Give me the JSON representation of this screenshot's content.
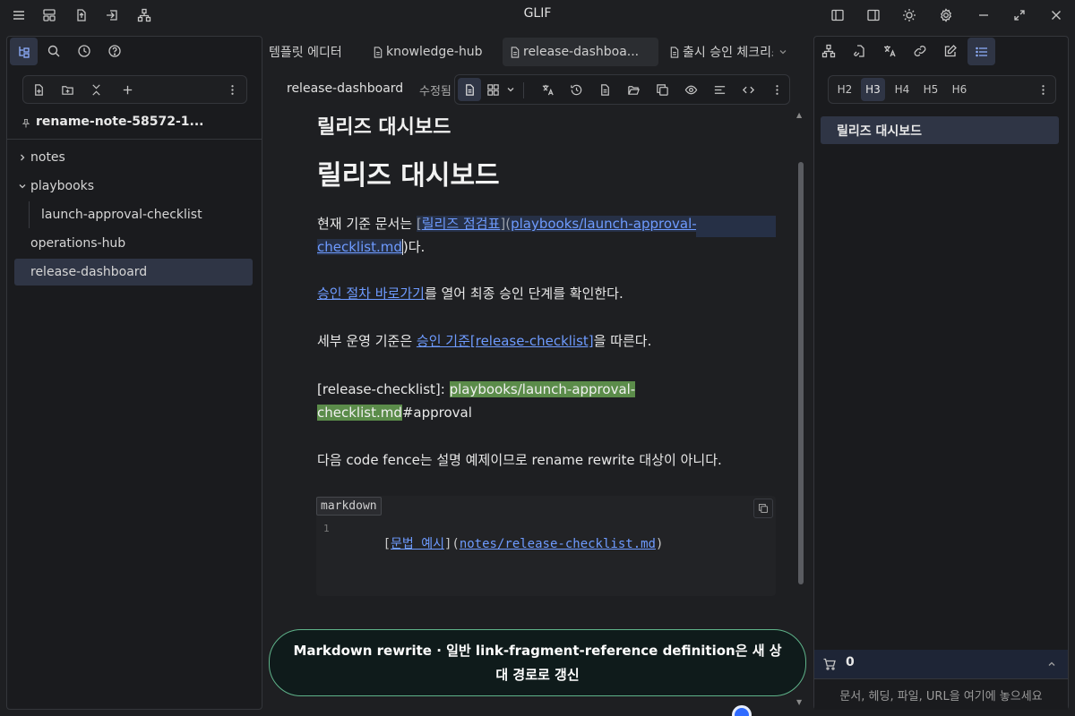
{
  "app": {
    "title": "GLIF"
  },
  "left": {
    "pinned_note": "rename-note-58572-1...",
    "tree": [
      {
        "label": "notes",
        "type": "folder",
        "expanded": false
      },
      {
        "label": "playbooks",
        "type": "folder",
        "expanded": true
      },
      {
        "label": "launch-approval-checklist",
        "type": "file",
        "indent": 1
      },
      {
        "label": "operations-hub",
        "type": "file"
      },
      {
        "label": "release-dashboard",
        "type": "file",
        "selected": true
      }
    ]
  },
  "tabs": [
    {
      "label": "템플릿 에디터"
    },
    {
      "label": "knowledge-hub"
    },
    {
      "label": "release-dashboa...",
      "active": true
    },
    {
      "label": "출시 승인 체크리스"
    }
  ],
  "editor": {
    "note_name": "release-dashboard",
    "mode_label": "수정됨",
    "doc_title": "릴리즈 대시보드",
    "heading": "릴리즈 대시보드",
    "p1": {
      "before": "현재 기준 문서는 ",
      "bracket_open": "[",
      "link_text": "릴리즈 점검표",
      "mid": "](",
      "url_part1": "playbooks/launch-approval-",
      "url_part2": "checklist.md",
      "after": ")다."
    },
    "p2": {
      "link_text": "승인 절차 바로가기",
      "after": "를 열어 최종 승인 단계를 확인한다."
    },
    "p3": {
      "before": "세부 운영 기준은 ",
      "link_text": "승인 기준",
      "ref_text": "[release-checklist]",
      "after": "을 따른다."
    },
    "p4": {
      "label": "[release-checklist]: ",
      "path_part1": "playbooks/launch-approval-",
      "path_part2": "checklist.md",
      "after": "#approval"
    },
    "p5": "다음 code fence는 설명 예제이므로 rename rewrite 대상이 아니다.",
    "code": {
      "lang": "markdown",
      "line_no": "1",
      "open": "[",
      "link_text": "문법 예시",
      "mid": "](",
      "url": "notes/release-checklist.md",
      "close": ")"
    }
  },
  "right": {
    "heading_buttons": [
      "H2",
      "H3",
      "H4",
      "H5",
      "H6"
    ],
    "active_heading": "H3",
    "outline": [
      {
        "label": "릴리즈 대시보드"
      }
    ],
    "cart_count": "0",
    "drop_placeholder": "문서, 헤딩, 파일, URL을 여기에 놓으세요"
  },
  "toast": {
    "message": "Markdown rewrite · 일반 link-fragment-reference definition은 새 상대 경로로 갱신"
  },
  "colors": {
    "accent": "#6e9bff",
    "selection": "#2f3545",
    "highlight": "#5b8c4a",
    "toast_border": "#5fb38a"
  }
}
